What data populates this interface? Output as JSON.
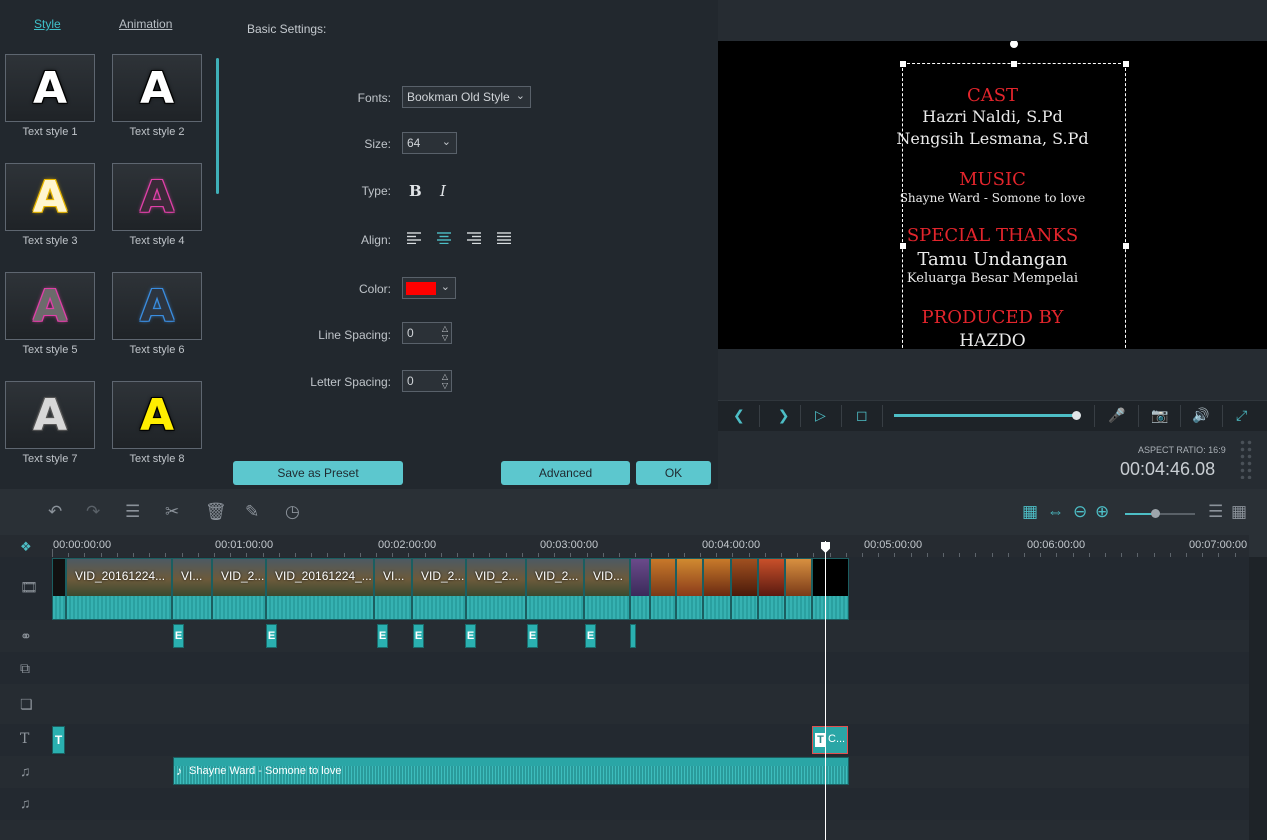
{
  "tabs": [
    {
      "label": "Style",
      "active": true
    },
    {
      "label": "Animation",
      "active": false
    }
  ],
  "text_styles": [
    {
      "label": "Text style 1",
      "letter": "A",
      "color": "#ffffff",
      "outline": "#000000"
    },
    {
      "label": "Text style 2",
      "letter": "A",
      "color": "#ffffff",
      "outline": "#000000"
    },
    {
      "label": "Text style 3",
      "letter": "A",
      "color": "#fff6cf",
      "outline": "#e8b600"
    },
    {
      "label": "Text style 4",
      "letter": "A",
      "color": "#3a2a38",
      "outline": "#e040a8"
    },
    {
      "label": "Text style 5",
      "letter": "A",
      "color": "#6b6b6b",
      "outline": "#e040a8"
    },
    {
      "label": "Text style 6",
      "letter": "A",
      "color": "#2d3540",
      "outline": "#3a8de0"
    },
    {
      "label": "Text style 7",
      "letter": "A",
      "color": "#d8d8d8",
      "outline": "#555555"
    },
    {
      "label": "Text style 8",
      "letter": "A",
      "color": "#ffee00",
      "outline": "#000000"
    }
  ],
  "settings": {
    "heading": "Basic Settings:",
    "fonts_label": "Fonts:",
    "font_value": "Bookman Old Style",
    "size_label": "Size:",
    "size_value": "64",
    "type_label": "Type:",
    "bold": "B",
    "italic": "I",
    "align_label": "Align:",
    "color_label": "Color:",
    "color_value": "#ff0000",
    "line_spacing_label": "Line Spacing:",
    "line_spacing_value": "0",
    "letter_spacing_label": "Letter Spacing:",
    "letter_spacing_value": "0"
  },
  "buttons": {
    "save_preset": "Save as Preset",
    "advanced": "Advanced",
    "ok": "OK"
  },
  "preview": {
    "lines": [
      {
        "text": "CAST",
        "style": "red",
        "size": 18
      },
      {
        "text": "Hazri Naldi, S.Pd",
        "style": "white",
        "size": 16
      },
      {
        "text": "Nengsih Lesmana, S.Pd",
        "style": "white",
        "size": 16
      },
      {
        "text": "MUSIC",
        "style": "red",
        "size": 18
      },
      {
        "text": "Shayne Ward - Somone to love",
        "style": "white",
        "size": 12
      },
      {
        "text": "SPECIAL THANKS",
        "style": "red",
        "size": 18
      },
      {
        "text": "Tamu Undangan",
        "style": "white",
        "size": 18
      },
      {
        "text": "Keluarga Besar Mempelai",
        "style": "white",
        "size": 13
      },
      {
        "text": "PRODUCED BY",
        "style": "red",
        "size": 18
      },
      {
        "text": "HAZDO",
        "style": "white",
        "size": 17
      }
    ],
    "aspect_ratio": "ASPECT RATIO: 16:9",
    "timecode": "00:04:46.08",
    "progress": 0.98
  },
  "timeline": {
    "ruler_labels": [
      "00:00:00:00",
      "00:01:00:00",
      "00:02:00:00",
      "00:03:00:00",
      "00:04:00:00",
      "00:05:00:00",
      "00:06:00:00",
      "00:07:00:00"
    ],
    "video_clips": [
      "VID_20161224...",
      "VI...",
      "VID_2...",
      "VID_20161224_...",
      "VI...",
      "VID_2...",
      "VID_2...",
      "VID_2...",
      "VID..."
    ],
    "transition_glyph": "E",
    "title_marker": "T",
    "title_clip": "C...",
    "audio_clip": "Shayne Ward - Somone to love"
  }
}
